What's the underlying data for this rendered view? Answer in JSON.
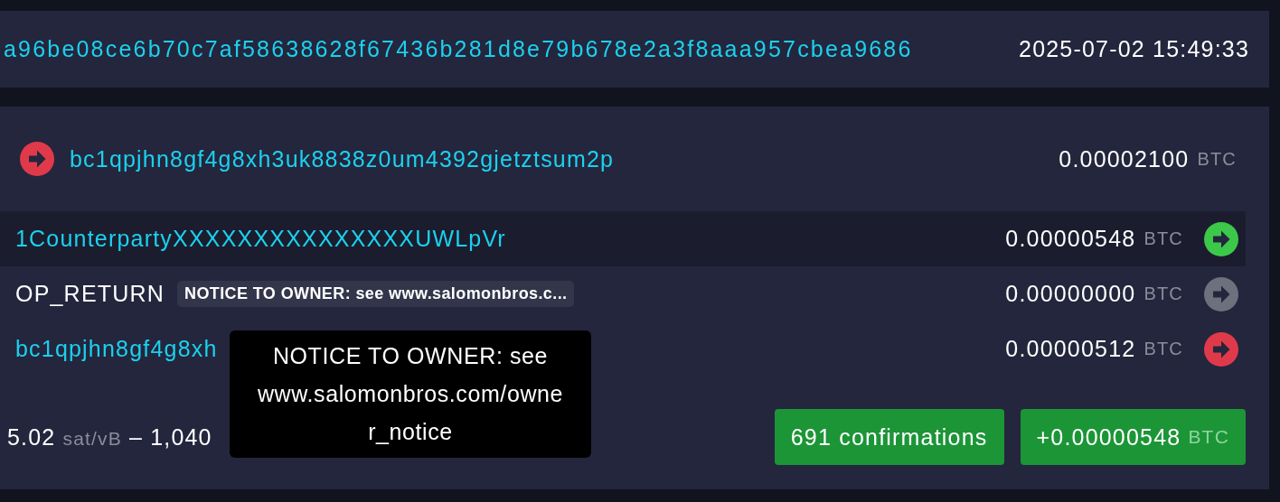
{
  "transaction": {
    "txid": "a96be08ce6b70c7af58638628f67436b281d8e79b678e2a3f8aaa957cbea9686",
    "time": "2025-07-02 15:49:33"
  },
  "inputs": [
    {
      "address": "bc1qpjhn8gf4g8xh3uk8838z0um4392gjetztsum2p",
      "amount": "0.00002100",
      "unit": "BTC",
      "color": "#e03a4a"
    }
  ],
  "outputs": [
    {
      "kind": "address",
      "address": "1CounterpartyXXXXXXXXXXXXXXXUWLpVr",
      "amount": "0.00000548",
      "unit": "BTC",
      "color": "#3cc94a",
      "selected": true
    },
    {
      "kind": "op_return",
      "address": "OP_RETURN",
      "tag": "NOTICE TO OWNER: see www.salomonbros.c...",
      "amount": "0.00000000",
      "unit": "BTC",
      "color": "#6c717d",
      "selected": false
    },
    {
      "kind": "address",
      "address": "bc1qpjhn8gf4g8xh",
      "amount": "0.00000512",
      "unit": "BTC",
      "color": "#e03a4a",
      "selected": false,
      "tooltip": "NOTICE TO OWNER: see www.salomonbros.com/owner_notice"
    }
  ],
  "fee": {
    "rate": "5.02",
    "rate_unit": "sat/vB",
    "separator": "–",
    "sats": "1,040"
  },
  "confirmations": "691 confirmations",
  "total": {
    "amount": "+0.00000548",
    "unit": "BTC"
  }
}
